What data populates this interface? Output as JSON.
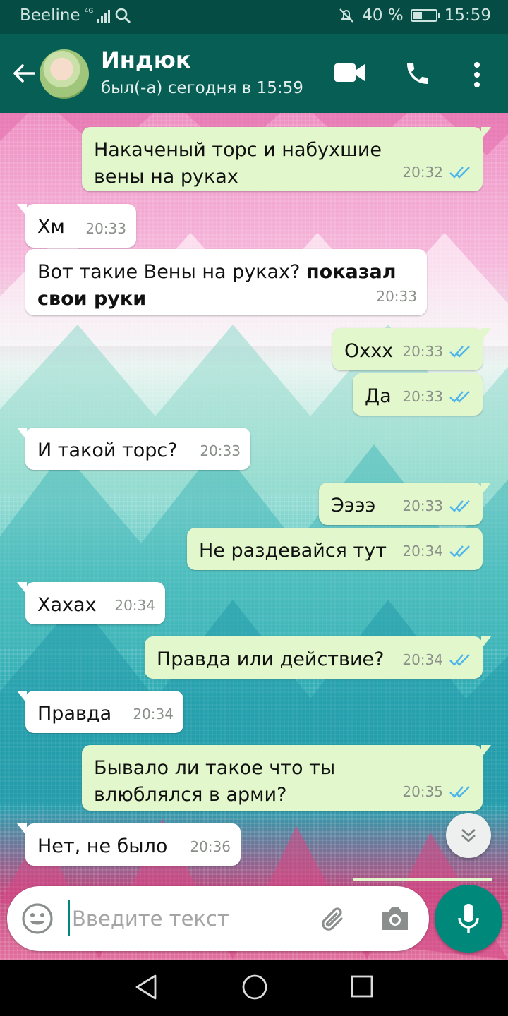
{
  "status_bar": {
    "carrier": "Beeline",
    "network": "4G",
    "battery": "40 %",
    "time": "15:59"
  },
  "header": {
    "contact_name": "Индюк",
    "last_seen": "был(-а) сегодня в 15:59",
    "icons": [
      "back-arrow-icon",
      "video-call-icon",
      "phone-icon",
      "more-vert-icon"
    ]
  },
  "messages": [
    {
      "dir": "out",
      "text": "Накаченый торс и набухшие вены на руках",
      "time": "20:32",
      "read": true
    },
    {
      "dir": "in",
      "text": "Хм",
      "time": "20:33"
    },
    {
      "dir": "in",
      "text": "Вот такие Вены на руках?",
      "bold": "показал свои руки",
      "time": "20:33"
    },
    {
      "dir": "out",
      "text": "Охxx",
      "time": "20:33",
      "read": true
    },
    {
      "dir": "out",
      "text": "Да",
      "time": "20:33",
      "read": true
    },
    {
      "dir": "in",
      "text": "И такой торс?",
      "time": "20:33"
    },
    {
      "dir": "out",
      "text": "Ээээ",
      "time": "20:33",
      "read": true
    },
    {
      "dir": "out",
      "text": "Не раздевайся тут",
      "time": "20:34",
      "read": true
    },
    {
      "dir": "in",
      "text": "Хахах",
      "time": "20:34"
    },
    {
      "dir": "out",
      "text": "Правда или действие?",
      "time": "20:34",
      "read": true
    },
    {
      "dir": "in",
      "text": "Правда",
      "time": "20:34"
    },
    {
      "dir": "out",
      "text": "Бывало ли такое что ты влюблялся в арми?",
      "time": "20:35",
      "read": true
    },
    {
      "dir": "in",
      "text": "Нет, не было",
      "time": "20:36"
    }
  ],
  "composer": {
    "placeholder": "Введите текст",
    "value": ""
  },
  "colors": {
    "header": "#075e54",
    "status_bar": "#054d44",
    "outgoing_bubble": "#e2f7cb",
    "incoming_bubble": "#ffffff",
    "accent": "#00897b",
    "read_ticks": "#4fb6ec"
  }
}
